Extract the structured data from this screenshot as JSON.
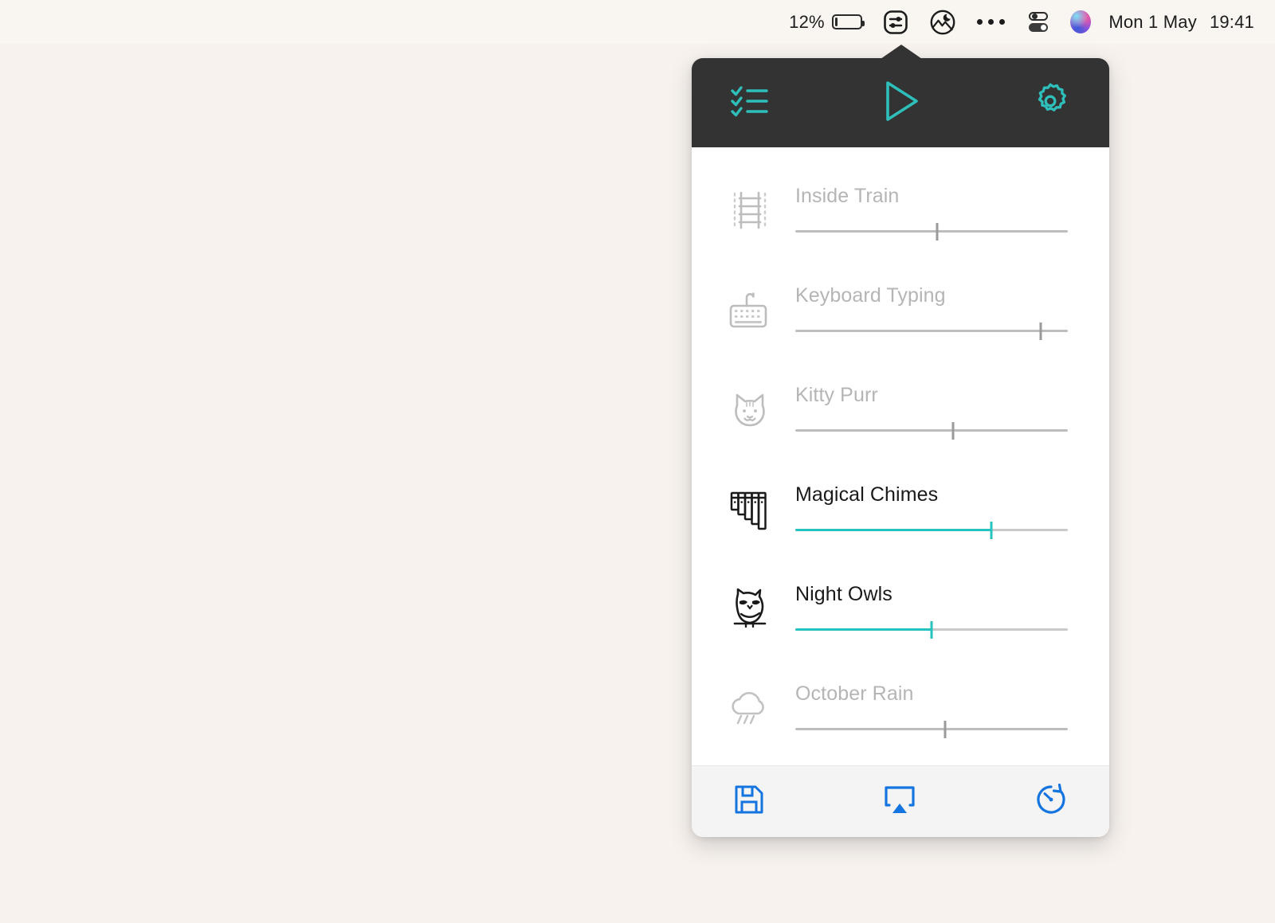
{
  "menubar": {
    "battery_percent": "12%",
    "battery_level": 12,
    "battery_icon": "battery-low-icon",
    "sync_icon": "sliders-in-rounded-square-icon",
    "app_icon": "moon-over-mountains-icon",
    "more_icon": "three-dots-icon",
    "control_center_icon": "control-center-toggles-icon",
    "siri_icon": "siri-orb-icon",
    "date": "Mon 1 May",
    "time": "19:41"
  },
  "panel": {
    "header": {
      "presets_icon": "checklist-icon",
      "play_icon": "play-triangle-icon",
      "settings_icon": "gear-icon",
      "accent_color": "#2fbfbb",
      "background_color": "#333333"
    },
    "sounds": [
      {
        "name": "Inside Train",
        "icon": "railroad-tracks-icon",
        "active": false,
        "volume": 52
      },
      {
        "name": "Keyboard Typing",
        "icon": "keyboard-icon",
        "active": false,
        "volume": 90
      },
      {
        "name": "Kitty Purr",
        "icon": "cat-face-icon",
        "active": false,
        "volume": 58
      },
      {
        "name": "Magical Chimes",
        "icon": "pan-flute-icon",
        "active": true,
        "volume": 72
      },
      {
        "name": "Night Owls",
        "icon": "owl-icon",
        "active": true,
        "volume": 50
      },
      {
        "name": "October Rain",
        "icon": "rain-cloud-icon",
        "active": false,
        "volume": 55
      }
    ],
    "footer": {
      "save_icon": "floppy-disk-save-icon",
      "airplay_icon": "airplay-icon",
      "timer_icon": "timer-icon",
      "accent_color": "#1575e0"
    }
  },
  "desktop": {
    "background_color": "#f7f2ee"
  }
}
